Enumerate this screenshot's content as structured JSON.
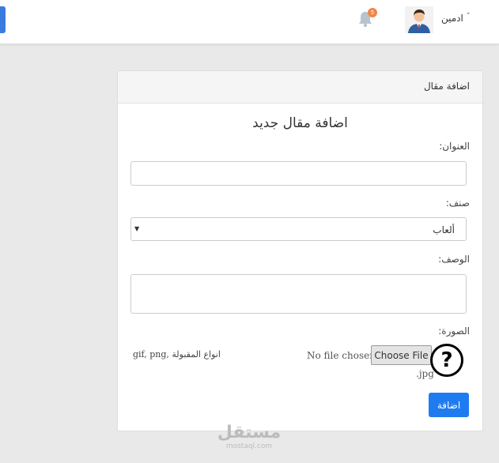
{
  "topbar": {
    "notification_count": "5",
    "user_name": "ادمين",
    "user_chevron": "˅",
    "icons": [
      "bell-icon",
      "avatar",
      "chevron-down-icon"
    ]
  },
  "card": {
    "header": "اضافة مقال",
    "form_title": "اضافة مقال جديد",
    "title_label": "العنوان:",
    "title_value": "",
    "category_label": "صنف:",
    "category_value": "ألعاب",
    "description_label": "الوصف:",
    "description_value": "",
    "image_label": "الصورة:",
    "file_button": "Choose File",
    "file_status": "No file chosen",
    "allowed_types_label": "انواع المقبولة",
    "allowed_types_value": "gif, png,",
    "allowed_types_extra": ".jpg",
    "help_symbol": "?",
    "submit_label": "اضافة"
  },
  "watermark": {
    "arabic": "مستقل",
    "latin": "mostaql.com"
  },
  "colors": {
    "accent": "#1f7cf0",
    "badge": "#f0864a",
    "background": "#e9e9e9"
  }
}
